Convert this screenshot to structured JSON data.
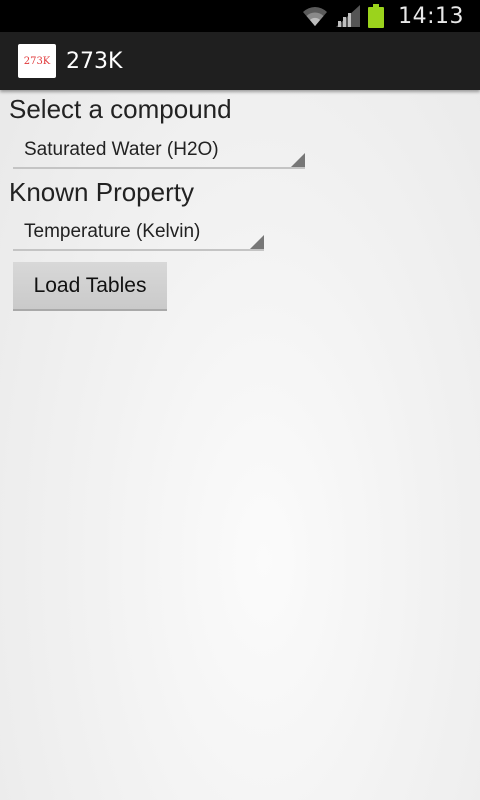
{
  "status_bar": {
    "time": "14:13",
    "icons": [
      "wifi-icon",
      "signal-icon",
      "battery-icon"
    ],
    "battery_color": "#9bd31c"
  },
  "action_bar": {
    "app_icon_text": "273K",
    "app_icon_color": "#e0393a",
    "title": "273K"
  },
  "form": {
    "compound_label": "Select a compound",
    "compound_value": "Saturated Water (H2O)",
    "property_label": "Known Property",
    "property_value": "Temperature (Kelvin)",
    "load_button_label": "Load Tables"
  }
}
